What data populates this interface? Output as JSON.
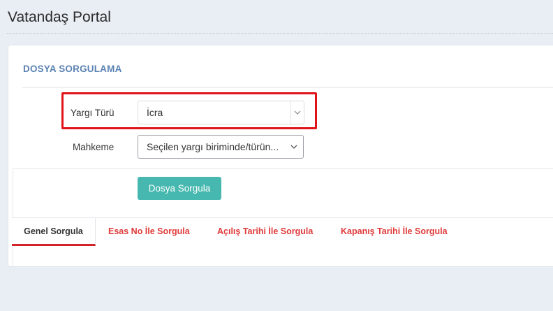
{
  "header": {
    "title": "Vatandaş Portal"
  },
  "card": {
    "title": "DOSYA SORGULAMA"
  },
  "form": {
    "yargi_turu": {
      "label": "Yargı Türü",
      "value": "İcra"
    },
    "mahkeme": {
      "label": "Mahkeme",
      "value": "Seçilen yargı biriminde/türün..."
    },
    "submit_label": "Dosya Sorgula"
  },
  "tabs": [
    {
      "label": "Genel Sorgula",
      "active": true
    },
    {
      "label": "Esas No İle Sorgula",
      "active": false
    },
    {
      "label": "Açılış Tarihi İle Sorgula",
      "active": false
    },
    {
      "label": "Kapanış Tarihi İle Sorgula",
      "active": false
    }
  ],
  "colors": {
    "accent_button": "#46b8af",
    "section_title": "#5a82b3",
    "tab_link": "#e03a3a",
    "highlight": "#e0131a"
  }
}
